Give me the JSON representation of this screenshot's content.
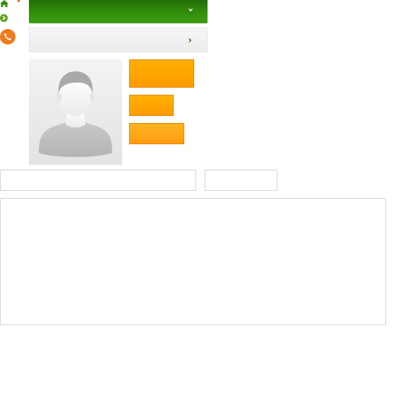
{
  "toolbar": {
    "home_icon": "home-icon",
    "go_icon": "arrow-right-circle-icon",
    "phone_icon": "phone-icon"
  },
  "dropdowns": [
    {
      "label": "",
      "icon": "chevron-down-icon",
      "color": "#2f8a0c"
    },
    {
      "label": "",
      "icon": "chevron-right-icon",
      "color": "#efefef"
    }
  ],
  "profile": {
    "avatar_icon": "default-avatar-icon"
  },
  "buttons": [
    {
      "label": "",
      "color": "#ff9f00"
    },
    {
      "label": "",
      "color": "#ff9f00"
    },
    {
      "label": "",
      "color": "#ffa41a"
    }
  ],
  "form": {
    "field_1": {
      "value": "",
      "placeholder": ""
    },
    "field_2": {
      "value": "",
      "placeholder": ""
    },
    "message": {
      "value": "",
      "placeholder": ""
    }
  },
  "colors": {
    "accent_green": "#2f8a0c",
    "accent_orange": "#ff9f00",
    "border_grey": "#d4d4d4"
  }
}
